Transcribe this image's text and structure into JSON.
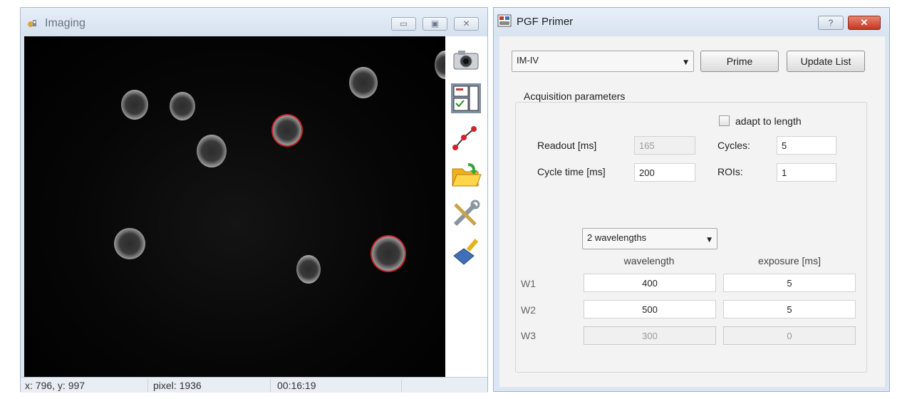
{
  "imaging": {
    "title": "Imaging",
    "window_buttons": {
      "minimize": "▭",
      "restore": "▣",
      "close": "✕"
    },
    "toolbar_icons": [
      "camera-icon",
      "layout-panels-icon",
      "line-path-icon",
      "folder-open-icon",
      "tools-icon",
      "brush-icon"
    ],
    "status": {
      "coords": "x: 796, y: 997",
      "pixel": "pixel: 1936",
      "time": "00:16:19"
    },
    "roi_color": "#c8262a"
  },
  "primer": {
    "title": "PGF Primer",
    "help_label": "?",
    "close_label": "✕",
    "protocol_select": "IM-IV",
    "prime_button": "Prime",
    "update_button": "Update List",
    "group_title": "Acquisition parameters",
    "adapt_label": "adapt to length",
    "adapt_checked": false,
    "readout_label": "Readout [ms]",
    "readout_value": "165",
    "cycle_time_label": "Cycle time [ms]",
    "cycle_time_value": "200",
    "cycles_label": "Cycles:",
    "cycles_value": "5",
    "rois_label": "ROIs:",
    "rois_value": "1",
    "wavelength_select": "2 wavelengths",
    "col_wavelength": "wavelength",
    "col_exposure": "exposure [ms]",
    "rows": [
      {
        "label": "W1",
        "wavelength": "400",
        "exposure": "5",
        "enabled": true
      },
      {
        "label": "W2",
        "wavelength": "500",
        "exposure": "5",
        "enabled": true
      },
      {
        "label": "W3",
        "wavelength": "300",
        "exposure": "0",
        "enabled": false
      }
    ]
  }
}
